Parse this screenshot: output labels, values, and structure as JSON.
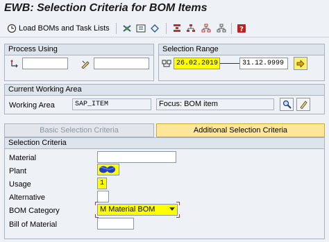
{
  "window": {
    "title": "EWB: Selection Criteria for BOM Items"
  },
  "toolbar": {
    "load_label": "Load BOMs and Task Lists",
    "icons": [
      "refresh-icon",
      "stop-icon",
      "variant-icon",
      "filter-icon",
      "hierarchy-icon",
      "tree-icon",
      "tree-alt-icon",
      "help-icon"
    ]
  },
  "process_using": {
    "title": "Process Using",
    "field1_value": "",
    "field2_value": ""
  },
  "selection_range": {
    "title": "Selection Range",
    "from_date": "26.02.2019",
    "to_date": "31.12.9999"
  },
  "working_area": {
    "title": "Current Working Area",
    "label": "Working Area",
    "value": "SAP_ITEM",
    "focus": "Focus: BOM item"
  },
  "tabs": {
    "basic": "Basic Selection Criteria",
    "additional": "Additional Selection Criteria"
  },
  "selection_criteria": {
    "title": "Selection Criteria",
    "material_label": "Material",
    "material_value": "",
    "plant_label": "Plant",
    "usage_label": "Usage",
    "usage_value": "1",
    "alternative_label": "Alternative",
    "alternative_value": "",
    "bom_category_label": "BOM Category",
    "bom_category_value": "M Material BOM",
    "bill_label": "Bill of Material",
    "bill_value": ""
  },
  "colors": {
    "highlight": "#ffff00",
    "marker": "#e02020",
    "plant_redacted": "#2040c0"
  }
}
